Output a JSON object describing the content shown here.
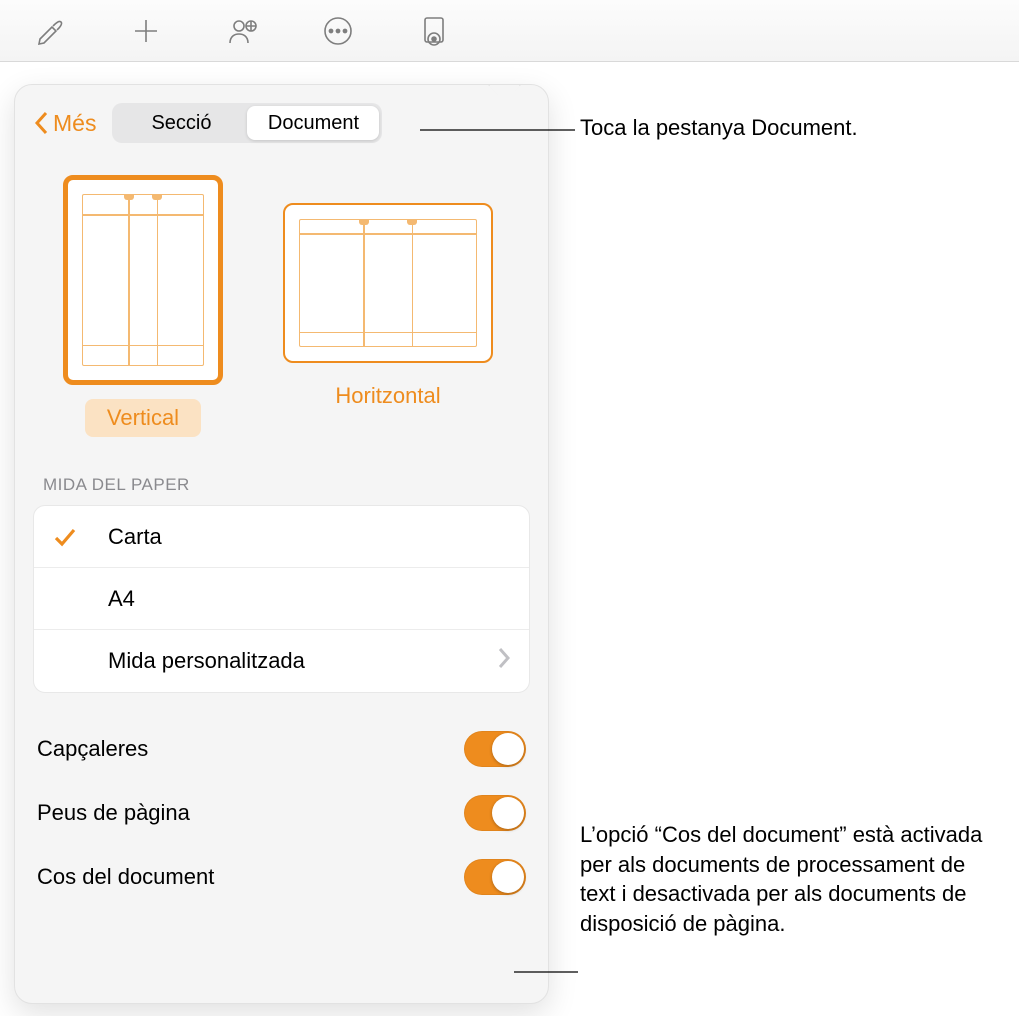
{
  "toolbar": {
    "icons": [
      "format-brush-icon",
      "add-icon",
      "collaborate-icon",
      "more-icon",
      "document-options-icon"
    ]
  },
  "panel": {
    "back_label": "Més",
    "tabs": {
      "section": "Secció",
      "document": "Document",
      "active": "document"
    },
    "orientation": {
      "vertical_label": "Vertical",
      "horizontal_label": "Horitzontal",
      "selected": "vertical"
    },
    "paper_size": {
      "title": "MIDA DEL PAPER",
      "options": [
        {
          "label": "Carta",
          "selected": true
        },
        {
          "label": "A4",
          "selected": false
        },
        {
          "label": "Mida personalitzada",
          "selected": false,
          "disclosure": true
        }
      ]
    },
    "toggles": {
      "headers": {
        "label": "Capçaleres",
        "on": true
      },
      "footers": {
        "label": "Peus de pàgina",
        "on": true
      },
      "body": {
        "label": "Cos del document",
        "on": true
      }
    }
  },
  "callouts": {
    "tab": "Toca la pestanya Document.",
    "body": "L’opció “Cos del document” està activada per als documents de processament de text i desactivada per als documents de disposició de pàgina."
  }
}
